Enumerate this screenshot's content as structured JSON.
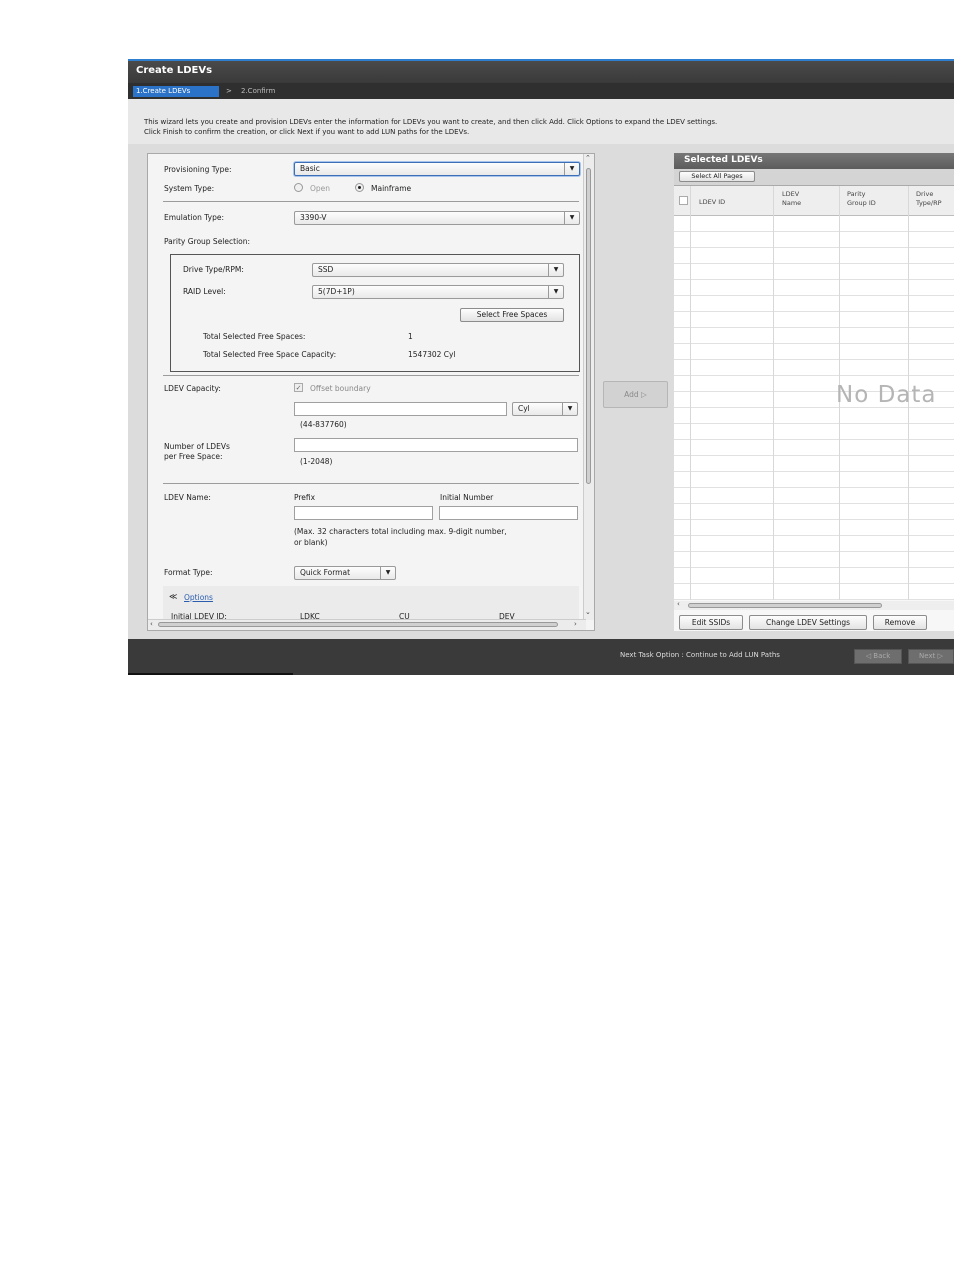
{
  "window": {
    "title": "Create LDEVs"
  },
  "steps": {
    "active": "1.Create LDEVs",
    "separator": ">",
    "next": "2.Confirm"
  },
  "intro": {
    "line1": "This wizard lets you create and provision LDEVs enter the information for  LDEVs you want to create, and then click Add. Click Options to expand the LDEV settings.",
    "line2": "Click Finish to confirm the creation, or click Next if you want to add LUN paths for the LDEVs."
  },
  "form": {
    "provisioning_type": {
      "label": "Provisioning Type:",
      "value": "Basic"
    },
    "system_type": {
      "label": "System Type:",
      "open": "Open",
      "mainframe": "Mainframe",
      "selected": "Mainframe"
    },
    "emulation_type": {
      "label": "Emulation Type:",
      "value": "3390-V"
    },
    "parity_group": {
      "label": "Parity Group Selection:",
      "drive_label": "Drive Type/RPM:",
      "drive_value": "SSD",
      "raid_label": "RAID Level:",
      "raid_value": "5(7D+1P)",
      "select_button": "Select Free Spaces",
      "total_spaces_label": "Total Selected Free Spaces:",
      "total_spaces_value": "1",
      "total_capacity_label": "Total Selected Free Space Capacity:",
      "total_capacity_value": "1547302 Cyl"
    },
    "ldev_capacity": {
      "label": "LDEV Capacity:",
      "offset_label": "Offset boundary",
      "unit": "Cyl",
      "range": "(44-837760)",
      "value": ""
    },
    "num_ldevs": {
      "label1": "Number of LDEVs",
      "label2": "per Free Space:",
      "range": "(1-2048)",
      "value": ""
    },
    "ldev_name": {
      "label": "LDEV Name:",
      "prefix_label": "Prefix",
      "initial_label": "Initial Number",
      "prefix_value": "",
      "initial_value": "",
      "hint1": "(Max. 32 characters total including max. 9-digit number,",
      "hint2": " or blank)"
    },
    "format_type": {
      "label": "Format Type:",
      "value": "Quick Format"
    },
    "options": {
      "link": "Options"
    },
    "initial_ldev": {
      "label": "Initial LDEV ID:",
      "ldkc": "LDKC",
      "cu": "CU",
      "dev": "DEV"
    }
  },
  "add_button": "Add ▷",
  "selected": {
    "title": "Selected LDEVs",
    "select_all": "Select All Pages",
    "columns": [
      {
        "l1": "LDEV ID",
        "l2": ""
      },
      {
        "l1": "LDEV",
        "l2": "Name"
      },
      {
        "l1": "Parity",
        "l2": "Group ID"
      },
      {
        "l1": "Drive",
        "l2": "Type/RP"
      }
    ],
    "empty_text": "No Data",
    "buttons": {
      "edit_ssids": "Edit SSIDs",
      "change_settings": "Change LDEV Settings",
      "remove": "Remove"
    }
  },
  "footer": {
    "next_task": "Next Task Option : Continue to Add LUN Paths",
    "back": "◁ Back",
    "next": "Next ▷"
  }
}
